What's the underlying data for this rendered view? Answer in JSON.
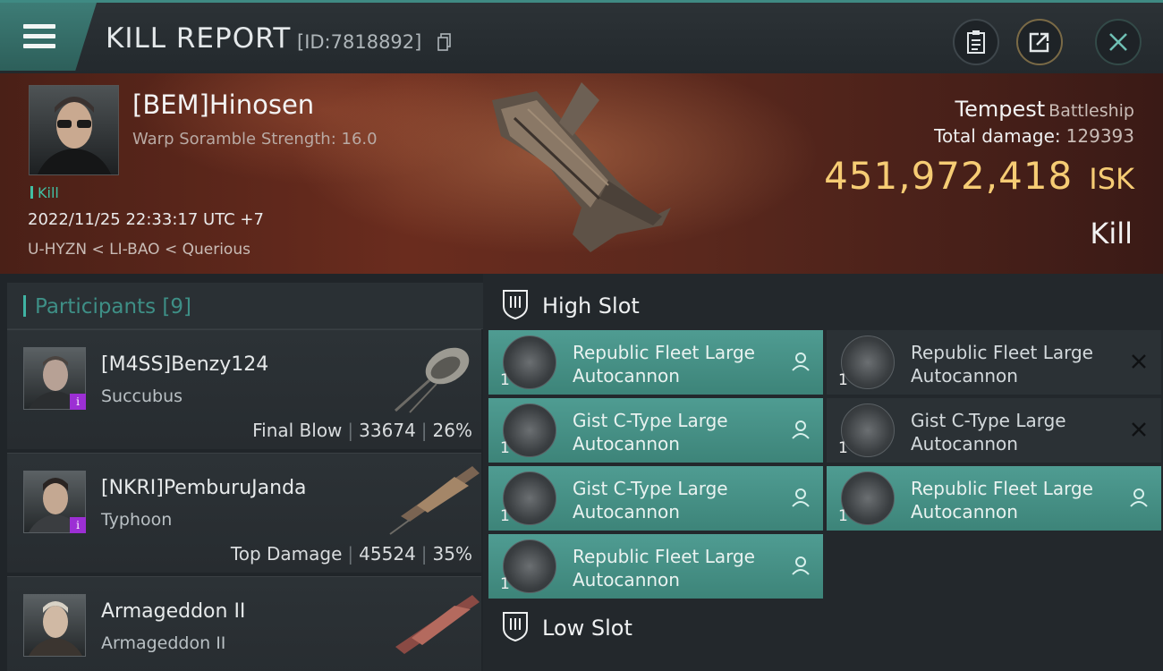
{
  "header": {
    "title": "KILL REPORT",
    "report_id": "[ID:7818892]",
    "icons": [
      "menu-icon",
      "copy-icon",
      "clipboard-icon",
      "share-icon",
      "close-icon"
    ]
  },
  "victim": {
    "name": "[BEM]Hinosen",
    "scramble": "Warp Soramble Strength: 16.0",
    "tag": "Kill",
    "datetime": "2022/11/25 22:33:17 UTC +7",
    "location": "U-HYZN < LI-BAO < Querious",
    "ship_name": "Tempest",
    "ship_class": "Battleship",
    "damage_label": "Total damage:",
    "damage_value": "129393",
    "isk_value": "451,972,418",
    "isk_unit": "ISK",
    "result": "Kill"
  },
  "participants": {
    "title": "Participants",
    "count": "[9]",
    "rows": [
      {
        "name": "[M4SS]Benzy124",
        "ship": "Succubus",
        "role": "Final Blow",
        "damage": "33674",
        "percent": "26%",
        "badge": "i"
      },
      {
        "name": "[NKRI]PemburuJanda",
        "ship": "Typhoon",
        "role": "Top Damage",
        "damage": "45524",
        "percent": "35%",
        "badge": "i"
      },
      {
        "name": "Armageddon II",
        "ship": "Armageddon II"
      }
    ]
  },
  "slots": {
    "high": {
      "title": "High Slot",
      "modules": [
        {
          "name_line1": "Republic Fleet Large",
          "name_line2": "Autocannon",
          "qty": "1",
          "state": "dropped"
        },
        {
          "name_line1": "Republic Fleet Large",
          "name_line2": "Autocannon",
          "qty": "1",
          "state": "destroyed"
        },
        {
          "name_line1": "Gist C-Type Large",
          "name_line2": "Autocannon",
          "qty": "1",
          "state": "dropped"
        },
        {
          "name_line1": "Gist C-Type Large",
          "name_line2": "Autocannon",
          "qty": "1",
          "state": "destroyed"
        },
        {
          "name_line1": "Gist C-Type Large",
          "name_line2": "Autocannon",
          "qty": "1",
          "state": "dropped"
        },
        {
          "name_line1": "Republic Fleet Large",
          "name_line2": "Autocannon",
          "qty": "1",
          "state": "dropped"
        },
        {
          "name_line1": "Republic Fleet Large",
          "name_line2": "Autocannon",
          "qty": "1",
          "state": "dropped"
        }
      ]
    },
    "low": {
      "title": "Low Slot"
    }
  },
  "colors": {
    "accent": "#3fb3a3",
    "isk": "#f6cc74",
    "dropped_module": "#4a968c",
    "destroyed_module": "#2b3135",
    "badge": "#9c2fd4"
  }
}
